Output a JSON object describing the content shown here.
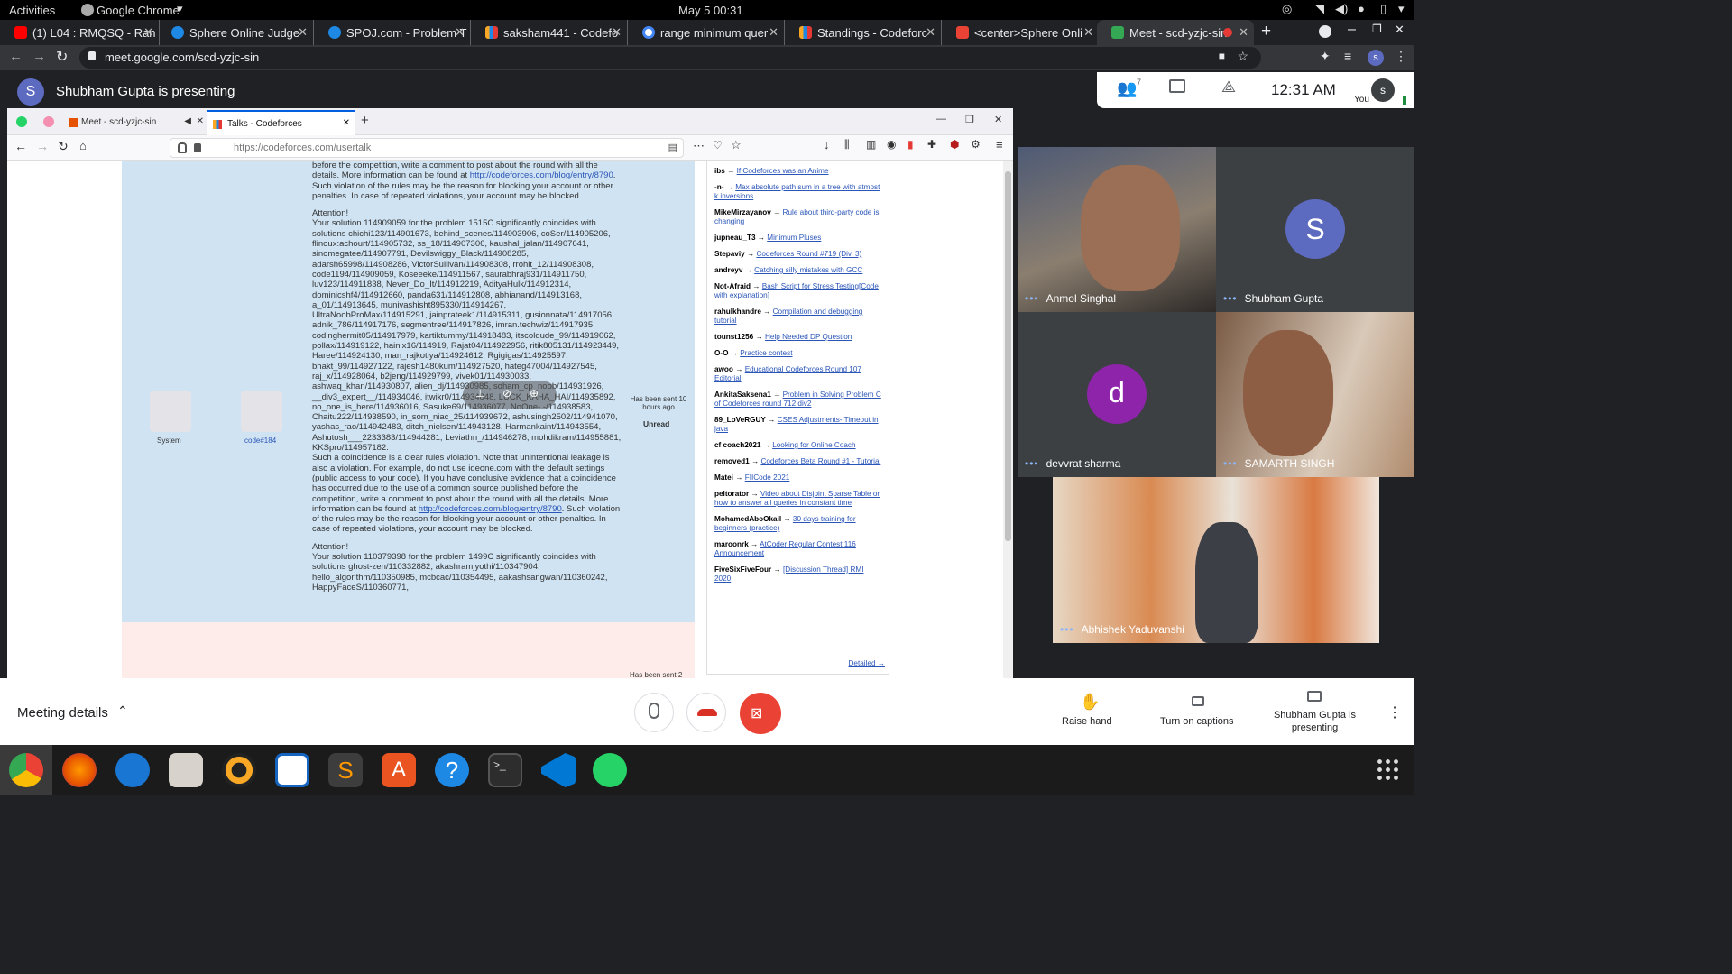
{
  "gnome": {
    "activities": "Activities",
    "app": "Google Chrome",
    "clock": "May 5  00:31"
  },
  "tabs": [
    {
      "label": "(1) L04 : RMQSQ - Ran",
      "color": "#ff0000"
    },
    {
      "label": "Sphere Online Judge",
      "color": "#1e88e5"
    },
    {
      "label": "SPOJ.com - Problem T",
      "color": "#1e88e5"
    },
    {
      "label": "saksham441 - Codefo",
      "color": "#f9a825"
    },
    {
      "label": "range minimum quer",
      "color": "#4285f4"
    },
    {
      "label": "Standings - Codeforc",
      "color": "#f9a825"
    },
    {
      "label": "<center>Sphere Onli",
      "color": "#ea4335"
    },
    {
      "label": "Meet - scd-yzjc-sin",
      "color": "#34a853"
    }
  ],
  "url": "meet.google.com/scd-yzjc-sin",
  "presenter": {
    "initial": "S",
    "text": "Shubham Gupta is presenting"
  },
  "meet_controls": {
    "people_count": "7",
    "time": "12:31  AM",
    "you_initial": "s",
    "you_label": "You"
  },
  "shared": {
    "ff_tabs": [
      {
        "label": "Meet - scd-yzjc-sin"
      },
      {
        "label": "Talks - Codeforces"
      }
    ],
    "ff_url": "https://codeforces.com/usertalk",
    "msg_text_1": "before the competition, write a comment to post about the round with all the details. More information can be found at ",
    "msg_link_1": "http://codeforces.com/blog/entry/8790",
    "msg_text_2": ". Such violation of the rules may be the reason for blocking your account or other penalties. In case of repeated violations, your account may be blocked.",
    "attention": "Attention!",
    "msg_body": "Your solution 114909059 for the problem 1515C significantly coincides with solutions chichi123/114901673, behind_scenes/114903906, coSer/114905206, flinoux:achourt/114905732, ss_18/114907306, kaushal_jalan/114907641, sinomegatee/114907791, Devilswiggy_Black/114908285, adarsh65998/114908286, VictorSullivan/114908308, rrohit_12/114908308, code1194/114909059, Koseeeke/114911567, saurabhraj931/114911750, luv123/114911838, Never_Do_It/114912219, AdityaHulk/114912314, dominicshf4/114912660, panda631/114912808, abhianand/114913168, a_01/114913645, munivashisht895330/114914267, UltraNoobProMax/114915291, jainprateek1/114915311, gusionnata/114917056, adnik_786/114917176, segmentree/114917826, imran.techwiz/114917935, codinghermit05/114917979, kartiktummy/114918483, itscoldude_99/114919062, pollax/114919122, hainix16/114919, Rajat04/114922956, ritik805131/114923449, Haree/114924130, man_rajkotiya/114924612, Rgigigas/114925597, bhakt_99/114927122, rajesh1480kum/114927520, hateg47004/114927545, raj_x/114928064, b2jeng/114929799, vivek01/114930033, ashwaq_khan/114930807, alien_dj/114930985, soham_cp_noob/114931926, __div3_expert__/114934046, itwikr0/114934848, LUCK_KAHA_HAI/114935892, no_one_is_here/114936016, Sasuke69/114936077, NoOne-.-/114938583, Chaitu222/114938590, in_som_niac_25/114939672, ashusingh2502/114941070, yashas_rao/114942483, ditch_nielsen/114943128, Harmankaint/114943554, Ashutosh___2233383/114944281, Leviathn_/114946278, mohdikram/114955881, KKSpro/114957182.",
    "msg_body_2": "Such a coincidence is a clear rules violation. Note that unintentional leakage is also a violation. For example, do not use ideone.com with the default settings (public access to your code). If you have conclusive evidence that a coincidence has occurred due to the use of a common source published before the competition, write a comment to post about the round with all the details. More information can be found at ",
    "msg_link_2": "http://codeforces.com/blog/entry/8790",
    "msg_body_3": ". Such violation of the rules may be the reason for blocking your account or other penalties. In case of repeated violations, your account may be blocked.",
    "attention_2": "Attention!",
    "msg_body_4": "Your solution 110379398 for the problem 1499C significantly coincides with solutions ghost-zen/110332882, akashramjyothi/110347904, hello_algorithm/110350985, mcbcac/110354495, aakashsangwan/110360242, HappyFaceS/110360771,",
    "system_label": "System",
    "code_label": "code#184",
    "sent": "Has been sent 10 hours ago",
    "unread": "Unread",
    "sent_2": "Has been sent 2",
    "sidebar": [
      {
        "user": "ibs",
        "title": "If Codeforces was an Anime"
      },
      {
        "user": "-n-",
        "title": "Max absolute path sum in a tree with atmost k inversions"
      },
      {
        "user": "MikeMirzayanov",
        "title": "Rule about third-party code is changing"
      },
      {
        "user": "jupneau_T3",
        "title": "Minimum Pluses"
      },
      {
        "user": "Stepaviy",
        "title": "Codeforces Round #719 (Div. 3)"
      },
      {
        "user": "andreyv",
        "title": "Catching silly mistakes with GCC"
      },
      {
        "user": "Not-Afraid",
        "title": "Bash Script for Stress Testing[Code with explanation]"
      },
      {
        "user": "rahulkhandre",
        "title": "Compilation and debugging tutorial"
      },
      {
        "user": "tounst1256",
        "title": "Help Needed DP Question"
      },
      {
        "user": "O-O",
        "title": "Practice contest"
      },
      {
        "user": "awoo",
        "title": "Educational Codeforces Round 107 Editorial"
      },
      {
        "user": "AnkitaSaksena1",
        "title": "Problem in Solving Problem C of Codeforces round 712 div2"
      },
      {
        "user": "89_LoVeRGUY",
        "title": "CSES Adjustments- Timeout in java"
      },
      {
        "user": "cf coach2021",
        "title": "Looking for Online Coach"
      },
      {
        "user": "removed1",
        "title": "Codeforces Beta Round #1 - Tutorial"
      },
      {
        "user": "Matei",
        "title": "FIICode 2021"
      },
      {
        "user": "peltorator",
        "title": "Video about Disjoint Sparse Table or how to answer all queries in constant time"
      },
      {
        "user": "MohamedAboOkail",
        "title": "30 days training for beginners (practice)"
      },
      {
        "user": "maroonrk",
        "title": "AtCoder Regular Contest 116 Announcement"
      },
      {
        "user": "FiveSixFiveFour",
        "title": "[Discussion Thread] RMI 2020"
      }
    ],
    "detailed": "Detailed →"
  },
  "participants": [
    {
      "name": "Anmol Singhal",
      "type": "video"
    },
    {
      "name": "Shubham Gupta",
      "type": "avatar",
      "initial": "S",
      "color": "#5c6bc0"
    },
    {
      "name": "devvrat sharma",
      "type": "avatar",
      "initial": "d",
      "color": "#8e24aa"
    },
    {
      "name": "SAMARTH SINGH",
      "type": "video"
    },
    {
      "name": "Abhishek Yaduvanshi",
      "type": "video"
    }
  ],
  "bottom": {
    "meeting_details": "Meeting details",
    "raise_hand": "Raise hand",
    "captions": "Turn on captions",
    "presenting": "Shubham Gupta is presenting"
  },
  "dock": [
    "chrome",
    "firefox",
    "thunderbird",
    "files",
    "rhythmbox",
    "writer",
    "sublime",
    "software",
    "help",
    "terminal",
    "vscode",
    "whatsapp"
  ]
}
